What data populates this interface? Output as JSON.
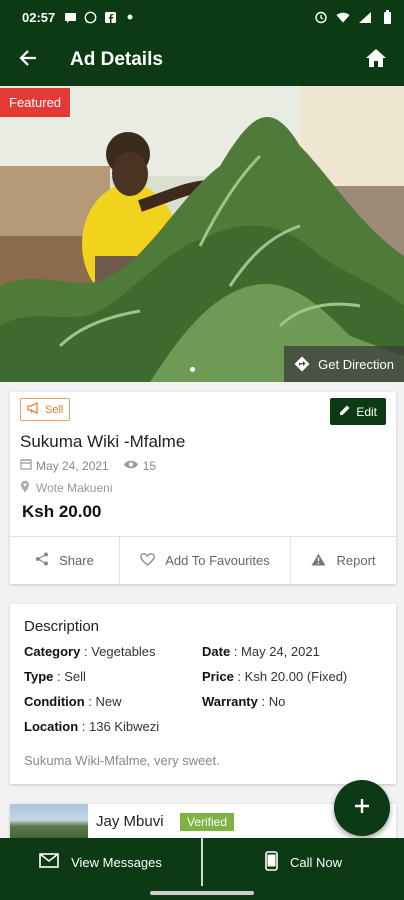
{
  "status_bar": {
    "time": "02:57"
  },
  "app_bar": {
    "title": "Ad Details"
  },
  "hero": {
    "featured_label": "Featured",
    "direction_label": "Get Direction"
  },
  "ad": {
    "type_chip": "Sell",
    "edit_label": "Edit",
    "title": "Sukuma Wiki -Mfalme",
    "date": "May 24, 2021",
    "views": "15",
    "location": "Wote Makueni",
    "price": "Ksh 20.00"
  },
  "actions": {
    "share": "Share",
    "favourite": "Add To Favourites",
    "report": "Report"
  },
  "description": {
    "heading": "Description",
    "fields": [
      {
        "label": "Category",
        "value": "Vegetables"
      },
      {
        "label": "Date",
        "value": "May 24, 2021"
      },
      {
        "label": "Type",
        "value": "Sell"
      },
      {
        "label": "Price",
        "value": "Ksh 20.00 (Fixed)"
      },
      {
        "label": "Condition",
        "value": "New"
      },
      {
        "label": "Warranty",
        "value": "No"
      },
      {
        "label": "Location",
        "value": "136 Kibwezi"
      }
    ],
    "text": "Sukuma Wiki-Mfalme, very sweet."
  },
  "seller": {
    "name": "Jay Mbuvi",
    "badge": "Verified"
  },
  "bottom_bar": {
    "messages": "View Messages",
    "call": "Call Now"
  },
  "colors": {
    "primary": "#0b3a14",
    "featured": "#e53935",
    "sell": "#e07b2c",
    "verified": "#7cb342"
  }
}
